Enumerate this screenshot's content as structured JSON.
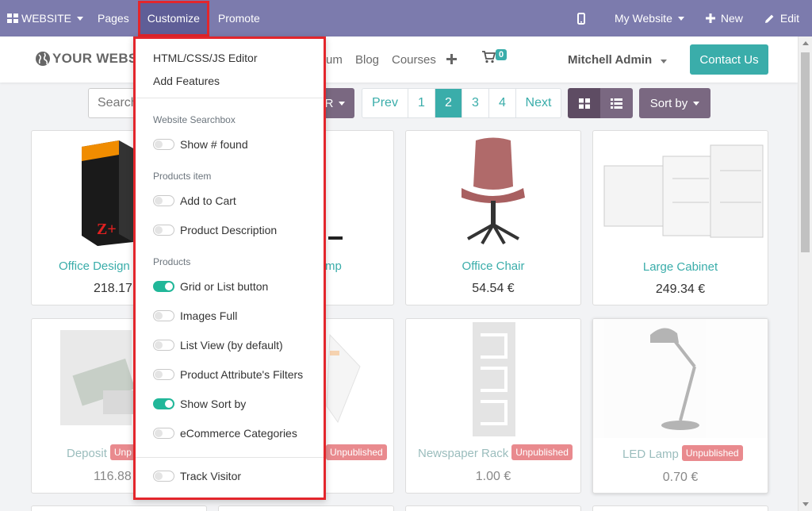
{
  "topbar": {
    "website_label": "WEBSITE",
    "pages_label": "Pages",
    "customize_label": "Customize",
    "promote_label": "Promote",
    "my_website_label": "My Website",
    "new_label": "New",
    "edit_label": "Edit",
    "bar_color": "#7c7bad"
  },
  "siteheader": {
    "logo_text": "YOUR WEBSITE",
    "nav": [
      "um",
      "Blog",
      "Courses"
    ],
    "cart_count": "0",
    "user_name": "Mitchell Admin",
    "contact_label": "Contact Us"
  },
  "toolbar": {
    "search_placeholder": "Search",
    "category_fragment": "R",
    "pager": {
      "prev": "Prev",
      "pages": [
        "1",
        "2",
        "3",
        "4"
      ],
      "active": "2",
      "next": "Next"
    },
    "sort_label": "Sort by"
  },
  "products": [
    {
      "name": "Office Design",
      "price": "218.17",
      "published": true
    },
    {
      "name": "mp",
      "price": "",
      "published": true
    },
    {
      "name": "Office Chair",
      "price": "54.54 €",
      "published": true
    },
    {
      "name": "Large Cabinet",
      "price": "249.34 €",
      "published": true
    },
    {
      "name": "Deposit",
      "price": "116.88",
      "badge": "Unp",
      "published": false
    },
    {
      "name": "",
      "price": "",
      "badge": "Unpublished",
      "published": false
    },
    {
      "name": "Newspaper Rack",
      "price": "1.00 €",
      "badge": "Unpublished",
      "published": false
    },
    {
      "name": "LED Lamp",
      "price": "0.70 €",
      "badge": "Unpublished",
      "published": false
    }
  ],
  "customize_menu": {
    "editor_label": "HTML/CSS/JS Editor",
    "add_features_label": "Add Features",
    "sections": [
      {
        "header": "Website Searchbox",
        "options": [
          {
            "label": "Show # found",
            "on": false
          }
        ]
      },
      {
        "header": "Products item",
        "options": [
          {
            "label": "Add to Cart",
            "on": false
          },
          {
            "label": "Product Description",
            "on": false
          }
        ]
      },
      {
        "header": "Products",
        "options": [
          {
            "label": "Grid or List button",
            "on": true
          },
          {
            "label": "Images Full",
            "on": false
          },
          {
            "label": "List View (by default)",
            "on": false
          },
          {
            "label": "Product Attribute's Filters",
            "on": false
          },
          {
            "label": "Show Sort by",
            "on": true
          },
          {
            "label": "eCommerce Categories",
            "on": false
          }
        ]
      }
    ],
    "track_visitor": {
      "label": "Track Visitor",
      "on": false
    }
  },
  "colors": {
    "teal": "#3aadaa",
    "highlight": "#e3262c",
    "toggle_on": "#21b799"
  }
}
